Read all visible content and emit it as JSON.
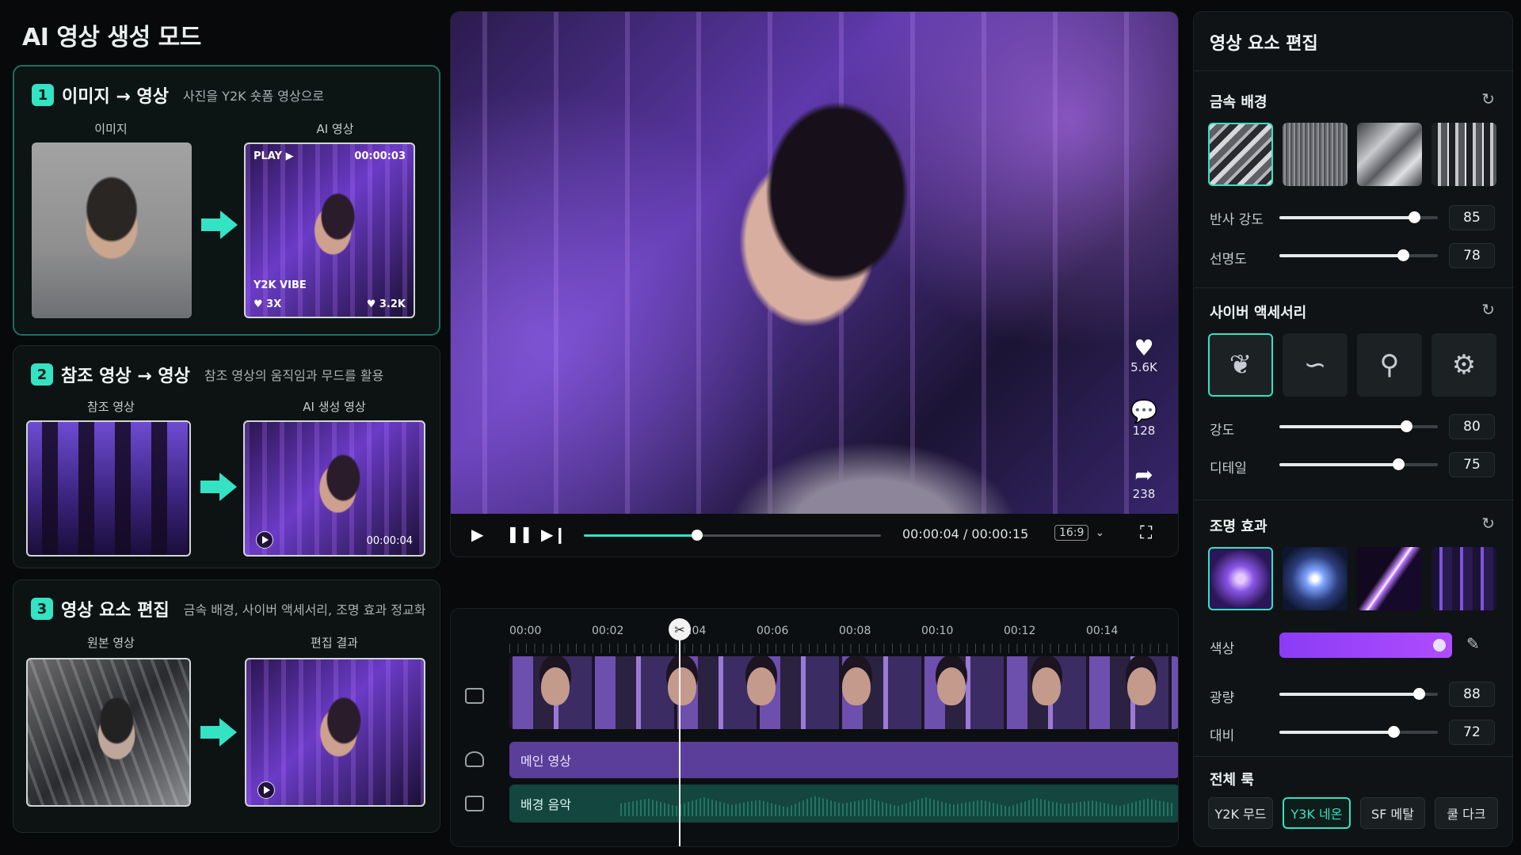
{
  "app": {
    "title": "AI 영상 생성 모드"
  },
  "steps": [
    {
      "num": "1",
      "title": "이미지 → 영상",
      "desc": "사진을 Y2K 숏폼 영상으로",
      "left_label": "이미지",
      "right_label": "AI 영상",
      "overlay": {
        "play": "PLAY ▶",
        "time": "00:00:03",
        "vibe": "Y2K VIBE",
        "likes_left": "♥ 3X",
        "likes_right": "♥ 3.2K"
      }
    },
    {
      "num": "2",
      "title": "참조 영상 → 영상",
      "desc": "참조 영상의 움직임과 무드를 활용",
      "left_label": "참조 영상",
      "right_label": "AI 생성 영상",
      "overlay": {
        "time": "00:00:04"
      }
    },
    {
      "num": "3",
      "title": "영상 요소 편집",
      "desc": "금속 배경, 사이버 액세서리, 조명 효과 정교화",
      "left_label": "원본 영상",
      "right_label": "편집 결과"
    }
  ],
  "preview": {
    "social": {
      "likes": "5.6K",
      "comments": "128",
      "shares": "238"
    },
    "time": "00:00:04 / 00:00:15",
    "progress": 0.38,
    "aspect_ratio": "16:9"
  },
  "timeline": {
    "ticks": [
      "00:00",
      "00:02",
      "00:04",
      "00:06",
      "00:08",
      "00:10",
      "00:12",
      "00:14"
    ],
    "main_track": "메인 영상",
    "music_track": "배경 음악"
  },
  "panel": {
    "title": "영상 요소 편집",
    "metal": {
      "title": "금속 배경",
      "sliders": [
        {
          "label": "반사 강도",
          "value": 85
        },
        {
          "label": "선명도",
          "value": 78
        }
      ]
    },
    "accessory": {
      "title": "사이버 액세서리",
      "sliders": [
        {
          "label": "강도",
          "value": 80
        },
        {
          "label": "디테일",
          "value": 75
        }
      ]
    },
    "lighting": {
      "title": "조명 효과",
      "color_label": "색상",
      "color": "#8a3cf5",
      "sliders": [
        {
          "label": "광량",
          "value": 88
        },
        {
          "label": "대비",
          "value": 72
        }
      ]
    },
    "look": {
      "title": "전체 룩",
      "options": [
        "Y2K 무드",
        "Y3K 네온",
        "SF 메탈",
        "쿨 다크"
      ],
      "selected": 1
    }
  },
  "colors": {
    "accent": "#33e3c3",
    "purple": "#5b3d9a"
  }
}
